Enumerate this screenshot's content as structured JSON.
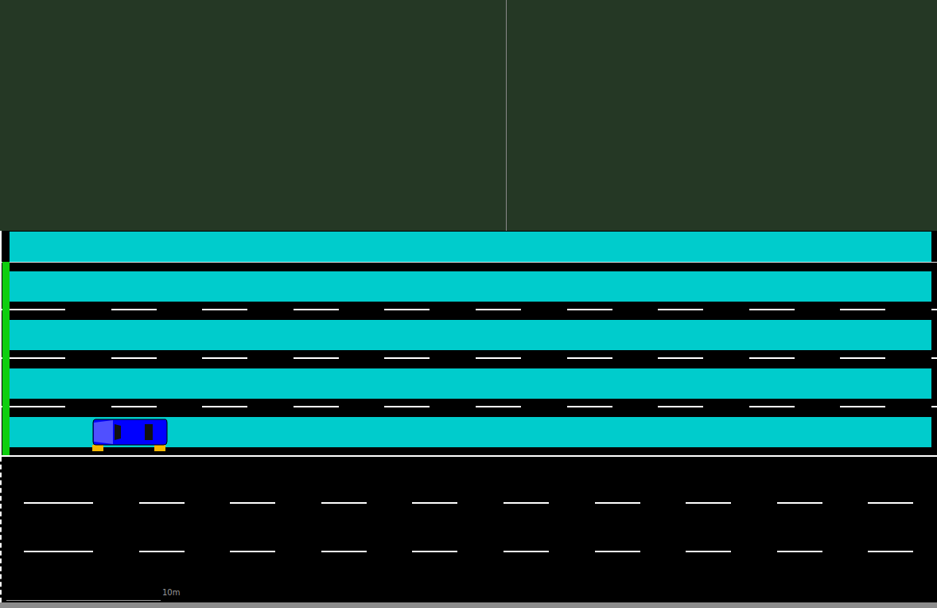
{
  "canvas": {
    "divider_visible": true
  },
  "upper_road": {
    "lanes": [
      {
        "highlighted": true,
        "marking": "thin"
      },
      {
        "highlighted": true,
        "marking": "dashed"
      },
      {
        "highlighted": true,
        "marking": "dashed"
      },
      {
        "highlighted": true,
        "marking": "dashed"
      },
      {
        "highlighted": true,
        "marking": "solid"
      }
    ]
  },
  "lower_road": {
    "lanes": [
      {
        "highlighted": false,
        "marking": "dashed"
      },
      {
        "highlighted": false,
        "marking": "dashed"
      },
      {
        "highlighted": false,
        "marking": "none"
      }
    ]
  },
  "signal": {
    "state": "green"
  },
  "vehicles": [
    {
      "lane": 4,
      "color": "#0000ff"
    }
  ],
  "scale_bar": {
    "label": "10m"
  }
}
